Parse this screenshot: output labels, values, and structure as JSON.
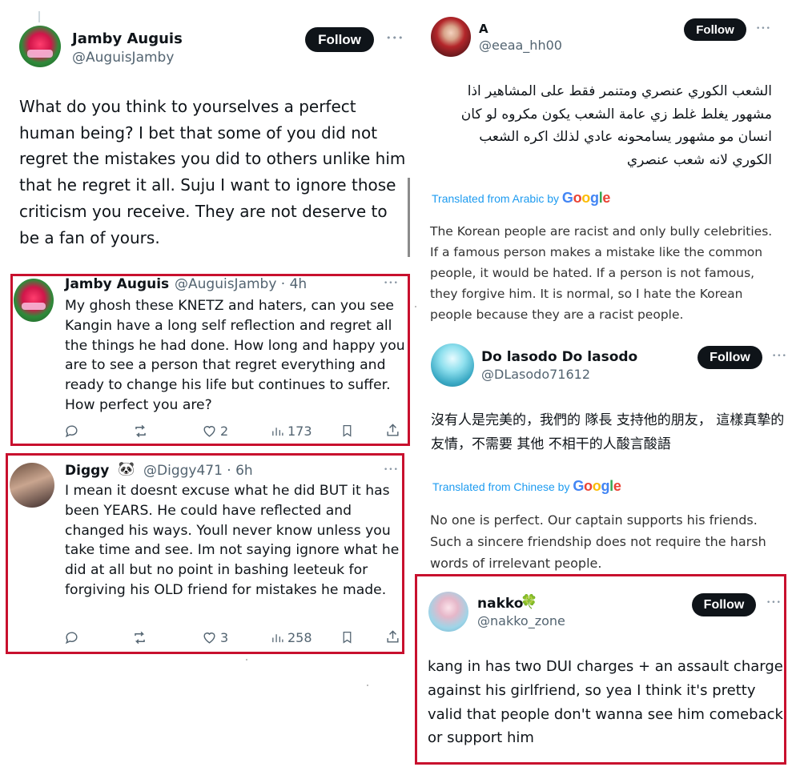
{
  "post1": {
    "name": "Jamby Auguis",
    "handle": "@AuguisJamby",
    "follow": "Follow",
    "more": "•••",
    "text": "What do you think to yourselves a perfect human being? I bet that some of you did not regret the mistakes you did to others unlike him that he regret it all. Suju I want to ignore those criticism you receive. They are not deserve to be a fan of yours."
  },
  "reply1": {
    "name": "Jamby Auguis",
    "handle": "@AuguisJamby · 4h",
    "more": "•••",
    "text": "My ghosh these KNETZ and haters, can you see Kangin have a long self reflection and regret all the things he had done. How long and happy you are to see a person that regret everything and ready to change his life but continues to suffer. How perfect you are?",
    "likes": "2",
    "views": "173",
    "retweets": "",
    "replies": ""
  },
  "reply2": {
    "name": "Diggy",
    "badge": "🐼",
    "handle": "@Diggy471 · 6h",
    "more": "•••",
    "text": "I mean it doesnt excuse what he did BUT it has been YEARS. He could have reflected and changed his ways.  Youll never know unless you take time and see. Im not saying ignore what he did at all but no point in bashing leeteuk for forgiving his OLD friend for mistakes he made.",
    "likes": "3",
    "views": "258"
  },
  "postA": {
    "name": "A",
    "handle": "@eeaa_hh00",
    "follow": "Follow",
    "more": "•••",
    "arabic": "الشعب الكوري عنصري ومتنمر فقط على المشاهير اذا مشهور يغلط غلط زي عامة الشعب يكون مكروه لو كان انسان مو مشهور يسامحونه عادي لذلك اكره الشعب الكوري لانه شعب عنصري",
    "translated_label": "Translated from Arabic by",
    "google": "Google",
    "translation": "The Korean people are racist and only bully celebrities. If a famous person makes a mistake like the common people, it would be hated. If a person is not famous, they forgive him. It is normal, so I hate the Korean people because they are a racist people."
  },
  "postDo": {
    "name": "Do lasodo Do lasodo",
    "handle": "@DLasodo71612",
    "follow": "Follow",
    "more": "•••",
    "chinese": "沒有人是完美的，我們的 隊長 支持他的朋友， 這樣真摯的友情，不需要 其他 不相干的人酸言酸語",
    "translated_label": "Translated from Chinese by",
    "google": "Google",
    "translation": "No one is perfect. Our captain supports his friends. Such a sincere friendship does not require the harsh words of irrelevant people."
  },
  "postNakko": {
    "name": "nakko",
    "badge": "🍀",
    "handle": "@nakko_zone",
    "follow": "Follow",
    "more": "•••",
    "text": "kang in has two DUI charges + an assault charge against his girlfriend, so yea I think it's pretty valid that people don't wanna see him comeback or support him"
  },
  "colors": {
    "highlight_border": "#c8102e",
    "follow_bg": "#0f1419",
    "translate_link": "#1d9bf0"
  }
}
